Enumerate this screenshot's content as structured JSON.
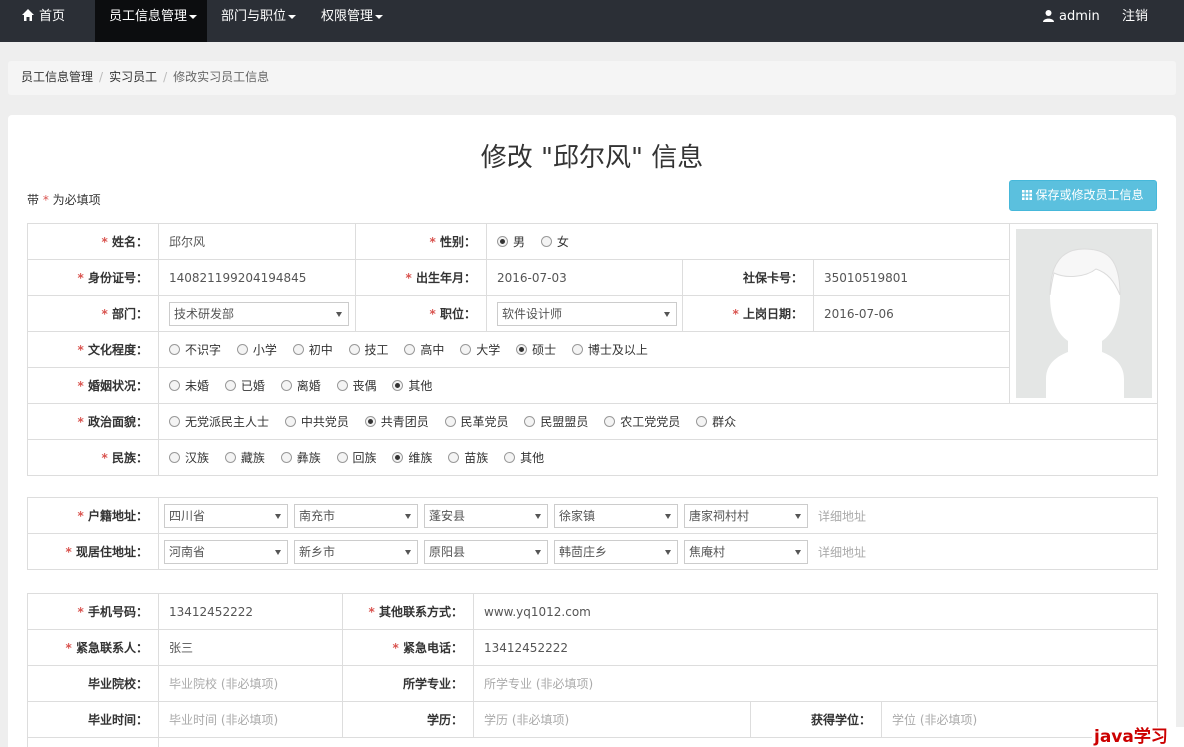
{
  "nav": {
    "home": "首页",
    "emp": "员工信息管理",
    "dept": "部门与职位",
    "perm": "权限管理",
    "user": "admin",
    "logout": "注销"
  },
  "breadcrumb": [
    "员工信息管理",
    "实习员工",
    "修改实习员工信息"
  ],
  "title": "修改 \"邱尔风\" 信息",
  "note": {
    "prefix": "带",
    "star": "*",
    "suffix": "为必填项"
  },
  "save_label": "保存或修改员工信息",
  "basic": {
    "name_label": "姓名：",
    "name": "邱尔风",
    "gender_label": "性别：",
    "genders": [
      "男",
      "女"
    ],
    "id_label": "身份证号：",
    "id": "140821199204194845",
    "birth_label": "出生年月：",
    "birth": "2016-07-03",
    "ss_label": "社保卡号：",
    "ss": "35010519801",
    "dept_label": "部门：",
    "dept": "技术研发部",
    "pos_label": "职位：",
    "pos": "软件设计师",
    "start_label": "上岗日期：",
    "start": "2016-07-06",
    "edu_label": "文化程度：",
    "edu": [
      "不识字",
      "小学",
      "初中",
      "技工",
      "高中",
      "大学",
      "硕士",
      "博士及以上"
    ],
    "marital_label": "婚姻状况：",
    "marital": [
      "未婚",
      "已婚",
      "离婚",
      "丧偶",
      "其他"
    ],
    "political_label": "政治面貌：",
    "political": [
      "无党派民主人士",
      "中共党员",
      "共青团员",
      "民革党员",
      "民盟盟员",
      "农工党党员",
      "群众"
    ],
    "ethnic_label": "民族：",
    "ethnic": [
      "汉族",
      "藏族",
      "彝族",
      "回族",
      "维族",
      "苗族",
      "其他"
    ]
  },
  "address": {
    "huji_label": "户籍地址：",
    "huji": [
      "四川省",
      "南充市",
      "蓬安县",
      "徐家镇",
      "唐家祠村村"
    ],
    "current_label": "现居住地址：",
    "current": [
      "河南省",
      "新乡市",
      "原阳县",
      "韩茴庄乡",
      "焦庵村"
    ],
    "detail_placeholder": "详细地址"
  },
  "contact": {
    "phone_label": "手机号码：",
    "phone": "13412452222",
    "other_label": "其他联系方式：",
    "other": "www.yq1012.com",
    "emergency_label": "紧急联系人：",
    "emergency": "张三",
    "ephone_label": "紧急电话：",
    "ephone": "13412452222",
    "school_label": "毕业院校：",
    "school_ph": "毕业院校 (非必填项)",
    "major_label": "所学专业：",
    "major_ph": "所学专业 (非必填项)",
    "gradtime_label": "毕业时间：",
    "gradtime_ph": "毕业时间 (非必填项)",
    "degree_label": "学历：",
    "degree_ph": "学历 (非必填项)",
    "title_label": "获得学位：",
    "title_ph": "学位 (非必填项)"
  },
  "watermark": "java学习"
}
